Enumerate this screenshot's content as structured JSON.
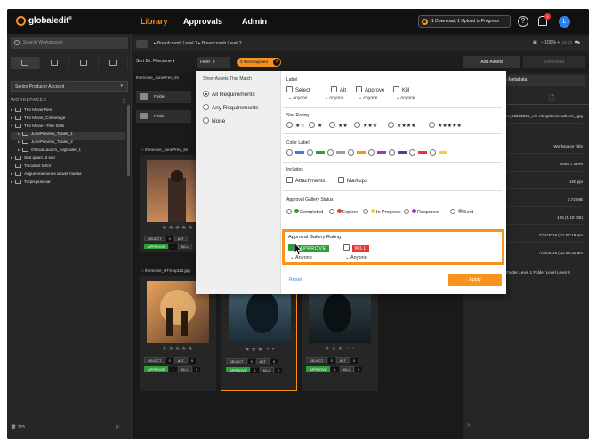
{
  "app": {
    "logo_text": "globaledit",
    "logo_tm": "®"
  },
  "nav": {
    "library": "Library",
    "approvals": "Approvals",
    "admin": "Admin"
  },
  "header": {
    "progress_text": "1 Download, 1 Upload in Progress",
    "help": "?",
    "bell_badge": "1",
    "avatar": "L"
  },
  "colors": {
    "accent": "#f7931e",
    "approve": "#2e9e3a",
    "kill": "#e53935",
    "link": "#2f80ed"
  },
  "sidebar": {
    "search_placeholder": "Search Workspaces",
    "account": "Senior Producer Account",
    "workspaces_label": "WORKSPACES",
    "items": [
      {
        "label": "The Movie Reel",
        "caret": "▸"
      },
      {
        "label": "The Movie_Coffeetage",
        "caret": "▸"
      },
      {
        "label": "The Movie - Film Stills",
        "caret": "▾"
      },
      {
        "label": "JunePreview_Trailer_1",
        "caret": "▸"
      },
      {
        "label": "JunePreview_Trailer_2",
        "caret": "▸"
      },
      {
        "label": "OfficialLaunch_Avgtrailer_1",
        "caret": "▸"
      },
      {
        "label": "Sed quam ut sed",
        "caret": "▸"
      },
      {
        "label": "Tincidunt tortor",
        "caret": ""
      },
      {
        "label": "Augue maecenas iaculis massa",
        "caret": "▸"
      },
      {
        "label": "Turpis pulvinar",
        "caret": "▸"
      }
    ],
    "trash_count": "215",
    "collapse": "|<"
  },
  "breadcrumb": {
    "text": "▸ Breadcrumb Level 1 ▸ Breadcrumb Level 2"
  },
  "view": {
    "zoom": "100%",
    "minus": "−",
    "plus": "+"
  },
  "toolbar": {
    "sort": "Sort By: Filename ▾",
    "filter": "Filter",
    "filters_applied": "3 filters applied",
    "add_assets": "Add Assets",
    "download": "Download"
  },
  "content": {
    "row1_name": "themovie_JunePrev_sti",
    "folder1": "Folder",
    "folder2": "Folder",
    "card_name_1": "themovie_JunePrev_sti",
    "card_name_2": "themovie_BTS-opt23.jpg",
    "select_label": "SELECT",
    "alt_label": "ALT",
    "approve_label": "APPROVE",
    "kill_label": "KILL",
    "zero": "0",
    "one": "1",
    "stars": "★★★★★",
    "stars3": "★★★ • •"
  },
  "right_panel": {
    "metadata_btn": "Metadata",
    "filename_full": "themovie_JunePrev_sti843560_ver vlongtitlesneatherie_.jpg",
    "workspace_title": "Workspace Title",
    "dimensions": "1920 x 1278",
    "ppi": "150 ppi",
    "size_mb": "0.72 MB",
    "size_gb": "125 (5.19 GB)",
    "date1": "7/24/2019 | 11:57:18 am",
    "date2": "7/24/2019 | 11:58:32 am",
    "path": "Film Folder Level 1 Folder Level Level 3",
    "collapse": ">|"
  },
  "filter_panel": {
    "show_assets_label": "Show Assets That Match",
    "match_options": [
      "All Requirements",
      "Any Requirements",
      "None"
    ],
    "label_title": "Label",
    "labels": [
      "Select",
      "Alt",
      "Approve",
      "Kill"
    ],
    "anyone": "Anyone",
    "star_title": "Star Rating",
    "star_options": [
      "★☆",
      "★",
      "★★",
      "★★★",
      "★★★★",
      "★★★★★"
    ],
    "color_title": "Color Label",
    "color_swatches": [
      "#2f80ed",
      "#2e9e3a",
      "#9e9e9e",
      "#f7931e",
      "#8e44ad",
      "#3949ab",
      "#e53935",
      "#f4d03f"
    ],
    "includes_title": "Includes",
    "includes": [
      "Attachments",
      "Markups"
    ],
    "status_title": "Approval Gallery Status",
    "statuses": [
      {
        "label": "Completed",
        "color": "#2e9e3a"
      },
      {
        "label": "Expired",
        "color": "#e53935"
      },
      {
        "label": "In Progress",
        "color": "#f4d03f"
      },
      {
        "label": "Reopened",
        "color": "#8e44ad"
      },
      {
        "label": "Sent",
        "color": "#9e9e9e"
      }
    ],
    "rating_title": "Approval Gallery Rating",
    "approve_pill": "APPROVE",
    "kill_pill": "KILL",
    "anyone_cap": "Anyone",
    "reset": "Reset",
    "apply": "Apply"
  }
}
